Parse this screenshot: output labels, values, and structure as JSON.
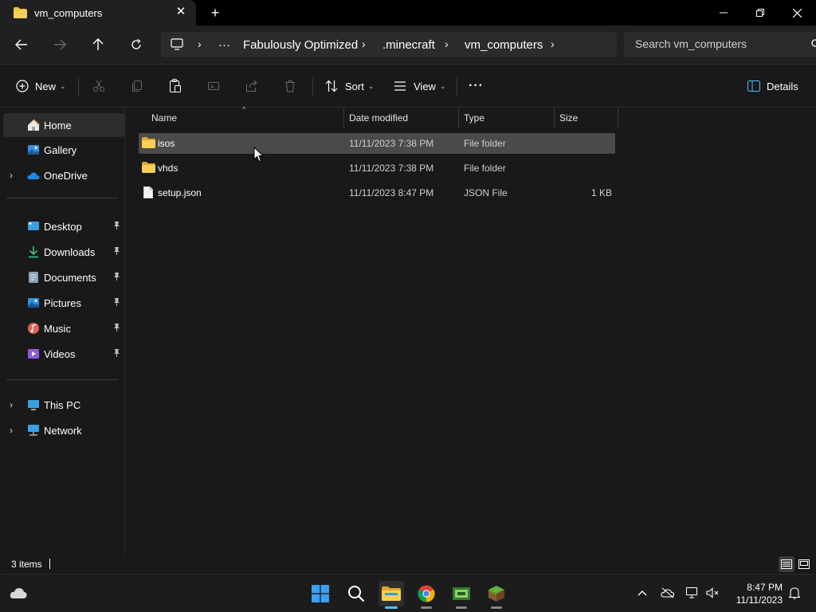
{
  "window": {
    "tab_title": "vm_computers",
    "tab_close": "✕",
    "new_tab": "+"
  },
  "address_bar": {
    "ellipsis": "···",
    "crumbs": [
      "Fabulously Optimized",
      ".minecraft",
      "vm_computers"
    ],
    "separator": "›"
  },
  "search": {
    "placeholder": "Search vm_computers"
  },
  "toolbar": {
    "new_label": "New",
    "sort_label": "Sort",
    "view_label": "View",
    "more_label": "···",
    "details_label": "Details",
    "caret": "⌄"
  },
  "sidebar": {
    "items": [
      {
        "label": "Home",
        "icon": "home-icon",
        "selected": true
      },
      {
        "label": "Gallery",
        "icon": "gallery-icon"
      },
      {
        "label": "OneDrive",
        "icon": "onedrive-icon"
      },
      {
        "label": "Desktop",
        "icon": "desktop-icon",
        "pinned": true
      },
      {
        "label": "Downloads",
        "icon": "downloads-icon",
        "pinned": true
      },
      {
        "label": "Documents",
        "icon": "documents-icon",
        "pinned": true
      },
      {
        "label": "Pictures",
        "icon": "pictures-icon",
        "pinned": true
      },
      {
        "label": "Music",
        "icon": "music-icon",
        "pinned": true
      },
      {
        "label": "Videos",
        "icon": "videos-icon",
        "pinned": true
      },
      {
        "label": "This PC",
        "icon": "this-pc-icon"
      },
      {
        "label": "Network",
        "icon": "network-icon"
      }
    ],
    "chevron": "›",
    "pin": "📌"
  },
  "file_list": {
    "columns": [
      "Name",
      "Date modified",
      "Type",
      "Size"
    ],
    "sort_caret": "^",
    "rows": [
      {
        "name": "isos",
        "date": "11/11/2023 7:38 PM",
        "type": "File folder",
        "size": "",
        "kind": "folder",
        "selected": true
      },
      {
        "name": "vhds",
        "date": "11/11/2023 7:38 PM",
        "type": "File folder",
        "size": "",
        "kind": "folder"
      },
      {
        "name": "setup.json",
        "date": "11/11/2023 8:47 PM",
        "type": "JSON File",
        "size": "1 KB",
        "kind": "file"
      }
    ]
  },
  "status": {
    "item_count": "3 items"
  },
  "taskbar": {
    "time": "8:47 PM",
    "date": "11/11/2023"
  },
  "colors": {
    "accent": "#4cc2ff",
    "folder": "#f0c040",
    "selection": "#4a4a4a"
  }
}
